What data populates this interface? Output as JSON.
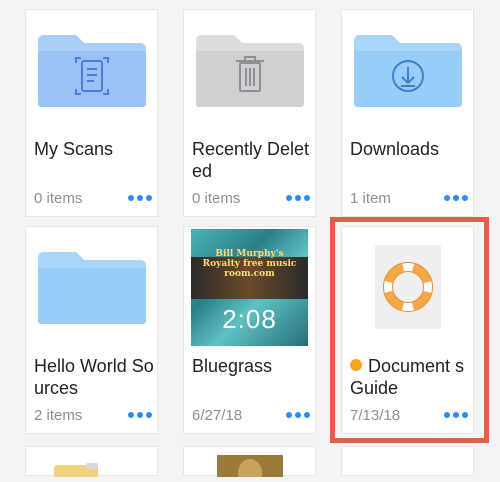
{
  "files": [
    {
      "name": "My Scans",
      "meta": "0 items",
      "icon": "scan-folder-icon"
    },
    {
      "name": "Recently Deleted",
      "meta": "0 items",
      "icon": "trash-folder-icon"
    },
    {
      "name": "Downloads",
      "meta": "1 item",
      "icon": "download-folder-icon"
    },
    {
      "name": "Hello World Sources",
      "meta": "2 items",
      "icon": "folder-icon"
    },
    {
      "name": "Bluegrass",
      "meta": "6/27/18",
      "icon": "video-thumbnail",
      "video": {
        "line1": "Bill Murphy's",
        "line2": "Royalty free music room.com",
        "duration": "2:08"
      }
    },
    {
      "name": "Document s Guide",
      "meta": "7/13/18",
      "icon": "lifebuoy-icon",
      "tag_color": "#f5a623"
    }
  ],
  "colors": {
    "highlight": "#e85c4a",
    "accent": "#2a8bf2",
    "folder_blue": "#9bc9f7",
    "folder_blue_dark": "#6aaaf2",
    "folder_gray": "#d6d6d9"
  }
}
